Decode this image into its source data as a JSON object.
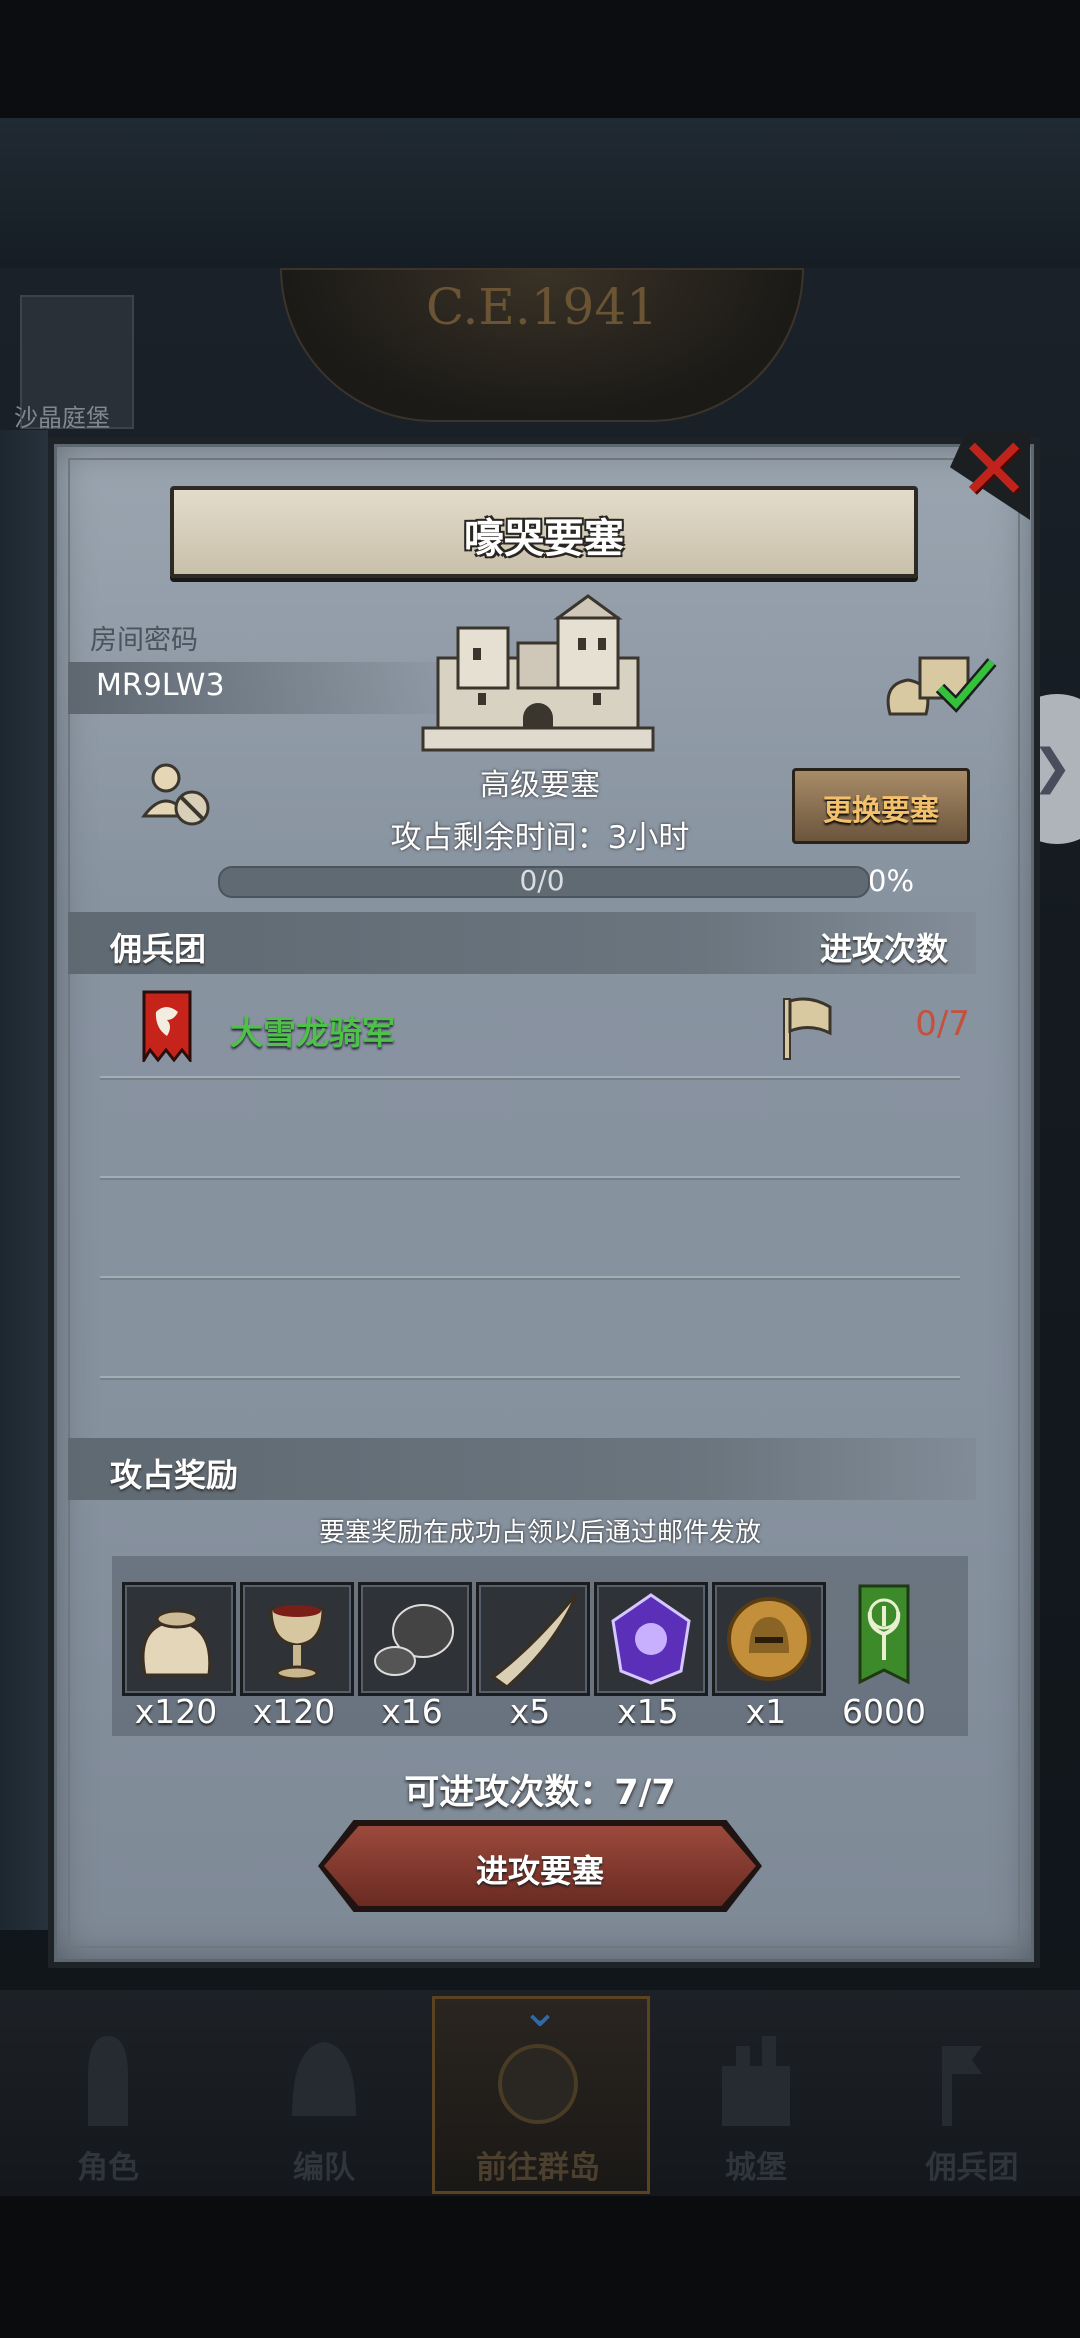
{
  "background": {
    "clock_year": "C.E.1941",
    "location_label": "沙晶庭堡"
  },
  "dialog": {
    "title": "嚎哭要塞",
    "room_password_label": "房间密码",
    "room_password_value": "MR9LW3",
    "fortress_type": "高级要塞",
    "change_fortress_button": "更换要塞",
    "remaining_time": "攻占剩余时间：3小时",
    "progress_text": "0/0",
    "progress_percent": "0%",
    "progress_fraction": 0,
    "mercenary_header": "佣兵团",
    "attack_count_header": "进攻次数",
    "mercenaries": [
      {
        "name": "大雪龙骑军",
        "attacks": "0/7"
      }
    ],
    "reward_header": "攻占奖励",
    "reward_note": "要塞奖励在成功占领以后通过邮件发放",
    "rewards": [
      {
        "icon": "sack-icon",
        "qty": "x120"
      },
      {
        "icon": "goblet-icon",
        "qty": "x120"
      },
      {
        "icon": "ore-icon",
        "qty": "x16"
      },
      {
        "icon": "horn-icon",
        "qty": "x5"
      },
      {
        "icon": "purple-gem-icon",
        "qty": "x15"
      },
      {
        "icon": "helmet-medal-icon",
        "qty": "x1"
      },
      {
        "icon": "tree-banner-icon",
        "qty": "6000"
      }
    ],
    "available_attacks": "可进攻次数：7/7",
    "attack_button": "进攻要塞"
  },
  "nav": {
    "items": [
      "角色",
      "编队",
      "前往群岛",
      "城堡",
      "佣兵团"
    ],
    "active_index": 2
  },
  "colors": {
    "accent_gold": "#f3c16b",
    "mercenary_green": "#4fc04a",
    "count_red": "#c5503e",
    "close_red": "#c0231b"
  }
}
